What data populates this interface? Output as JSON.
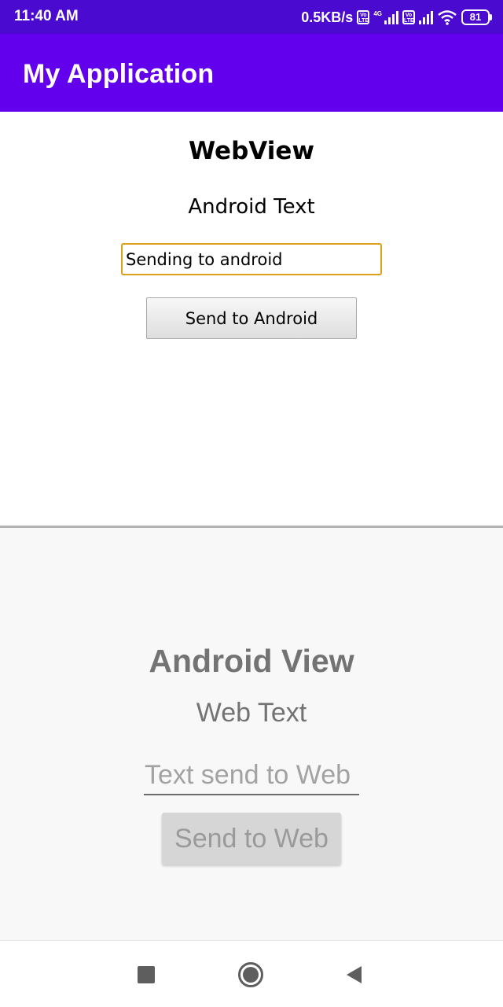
{
  "status_bar": {
    "time": "11:40 AM",
    "net_speed": "0.5KB/s",
    "volte_label": "Vo LTE",
    "network_type": "4G",
    "battery": "81",
    "icons": [
      "volte-icon",
      "signal-4g-icon",
      "volte-icon",
      "signal-icon",
      "wifi-icon",
      "battery-icon"
    ]
  },
  "app_bar": {
    "title": "My Application"
  },
  "webview": {
    "heading": "WebView",
    "text": "Android Text",
    "input_value": "Sending to android",
    "button_label": "Send to Android"
  },
  "android_view": {
    "heading": "Android View",
    "text": "Web Text",
    "input_placeholder": "Text send to Web",
    "button_label": "Send to Web"
  },
  "nav_bar": {
    "icons": [
      "recents-icon",
      "home-icon",
      "back-icon"
    ]
  },
  "colors": {
    "status_bar": "#4a0ad0",
    "app_bar": "#6200ee",
    "input_focus_border": "#d9a21a"
  }
}
